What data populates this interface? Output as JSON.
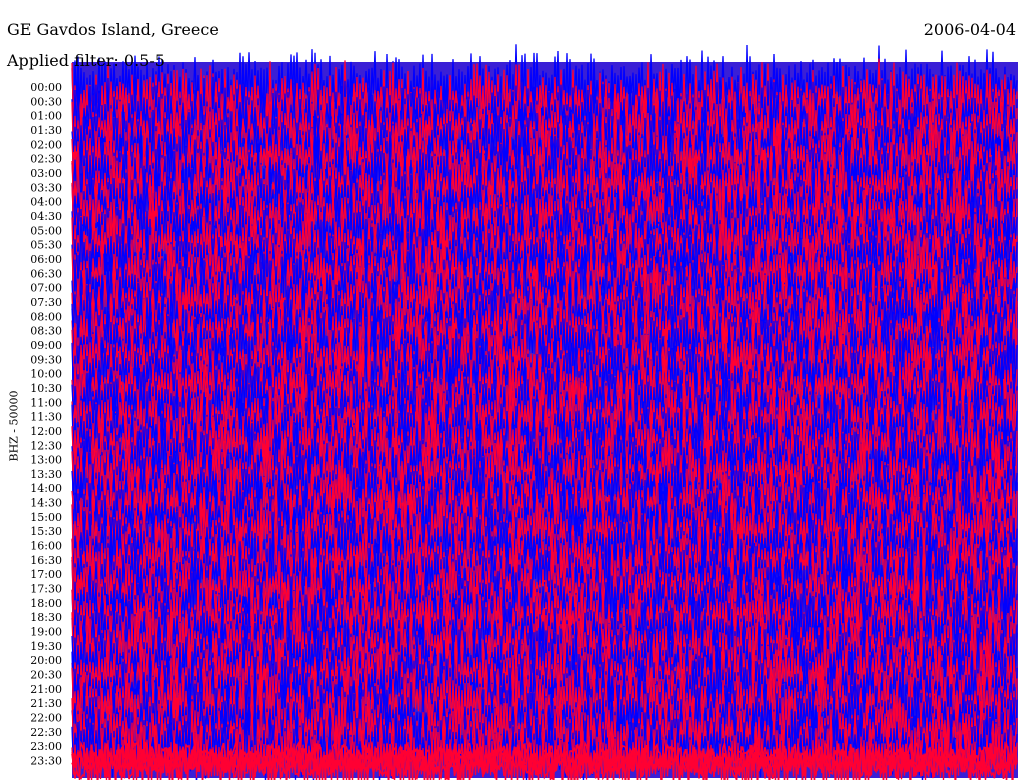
{
  "header": {
    "station": "GE Gavdos Island, Greece",
    "date": "2006-04-04",
    "filter": "Applied filter: 0.5-5"
  },
  "chart_data": {
    "type": "line",
    "title": "GE Gavdos Island, Greece",
    "ylabel": "BHZ - 50000",
    "xlabel": "",
    "y_ticks": [
      "00:00",
      "00:30",
      "01:00",
      "01:30",
      "02:00",
      "02:30",
      "03:00",
      "03:30",
      "04:00",
      "04:30",
      "05:00",
      "05:30",
      "06:00",
      "06:30",
      "07:00",
      "07:30",
      "08:00",
      "08:30",
      "09:00",
      "09:30",
      "10:00",
      "10:30",
      "11:00",
      "11:30",
      "12:00",
      "12:30",
      "13:00",
      "13:30",
      "14:00",
      "14:30",
      "15:00",
      "15:30",
      "16:00",
      "16:30",
      "17:00",
      "17:30",
      "18:00",
      "18:30",
      "19:00",
      "19:30",
      "20:00",
      "20:30",
      "21:00",
      "21:30",
      "22:00",
      "22:30",
      "23:00",
      "23:30"
    ],
    "trace_colors": [
      "#0000ff",
      "#ff0033"
    ],
    "trace_count": 48,
    "saturated": true,
    "grid": false
  }
}
